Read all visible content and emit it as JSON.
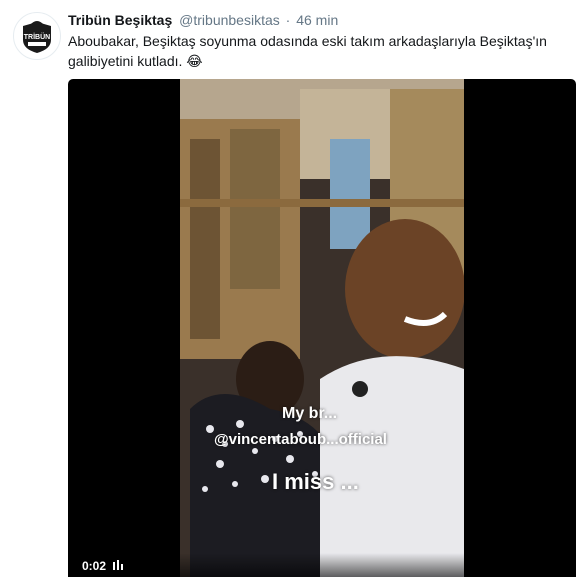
{
  "tweet": {
    "display_name": "Tribün Beşiktaş",
    "handle": "@tribunbesiktas",
    "separator": "·",
    "time": "46 min",
    "text": "Aboubakar, Beşiktaş soyunma odasında eski takım arkadaşlarıyla Beşiktaş'ın galibiyetini kutladı.",
    "emoji": "😂",
    "avatar_icon": "tribun-besiktas-logo"
  },
  "video": {
    "overlay_line1": "My br...",
    "overlay_line2": "@vincentaboub...official",
    "overlay_line3": "I miss ...",
    "timestamp": "0:02",
    "progress_fraction": 0.04
  },
  "colors": {
    "text": "#14171a",
    "secondary": "#657786",
    "background": "#ffffff"
  }
}
